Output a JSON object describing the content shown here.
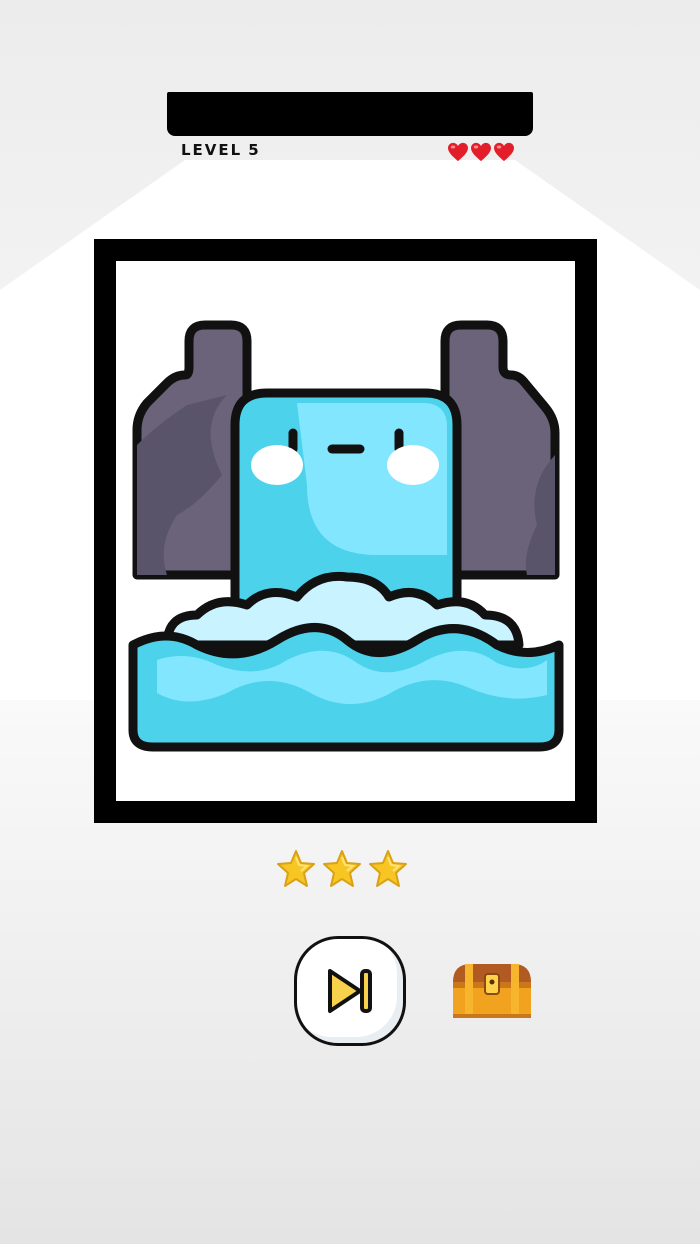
{
  "hud": {
    "level_label": "LEVEL",
    "level_number": "5",
    "lives": 3,
    "heart_color": "#e31e2b"
  },
  "puzzle": {
    "image_icon": "waterfall-icon",
    "colors": {
      "rock": "#6a6379",
      "water_light": "#83e6ff",
      "water_dark": "#4dd2ec",
      "foam": "#c9f3ff",
      "outline": "#111111"
    }
  },
  "rating": {
    "stars": 3,
    "star_color": "#f8c623"
  },
  "controls": {
    "skip_icon": "skip-forward-icon",
    "chest_icon": "treasure-chest-icon"
  }
}
